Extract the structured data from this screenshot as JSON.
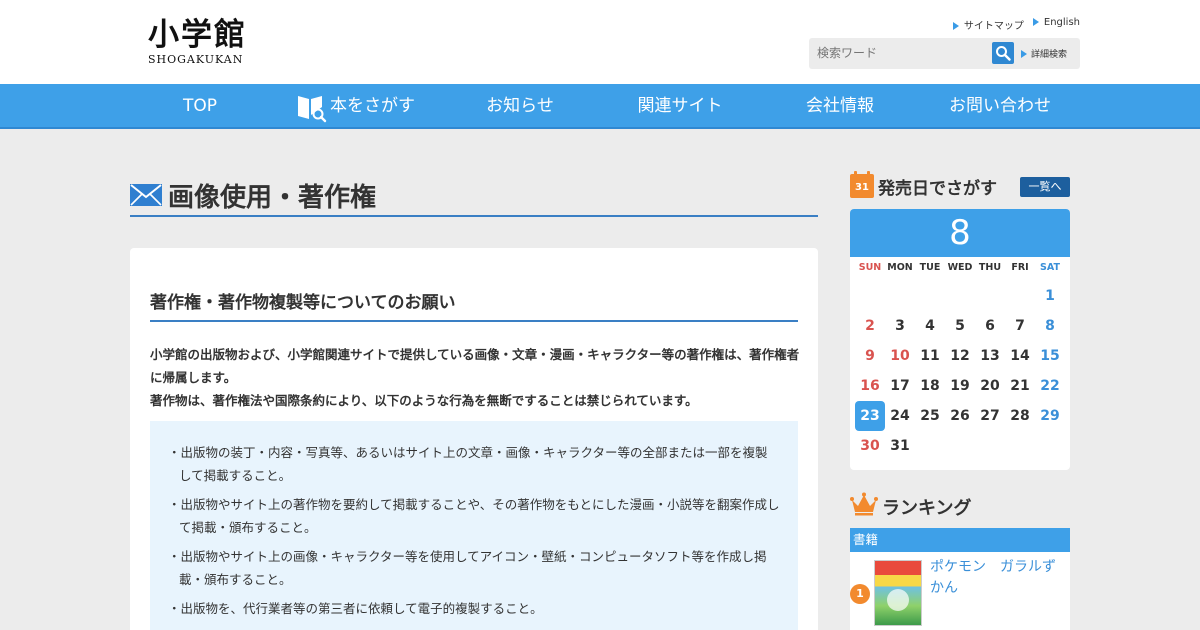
{
  "header": {
    "logo_jp": "小学館",
    "logo_en": "SHOGAKUKAN",
    "links": [
      "サイトマップ",
      "English"
    ],
    "search": {
      "placeholder": "検索ワード",
      "advanced_label": "詳細検索"
    }
  },
  "nav": {
    "items": [
      "TOP",
      "本をさがす",
      "お知らせ",
      "関連サイト",
      "会社情報",
      "お問い合わせ"
    ]
  },
  "main": {
    "title": "画像使用・著作権",
    "section_title": "著作権・著作物複製等についてのお願い",
    "intro_line1": "小学館の出版物および、小学館関連サイトで提供している画像・文章・漫画・キャラクター等の著作権は、著作権者に帰属します。",
    "intro_line2": "著作物は、著作権法や国際条約により、以下のような行為を無断ですることは禁じられています。",
    "notices": [
      "・出版物の装丁・内容・写真等、あるいはサイト上の文章・画像・キャラクター等の全部または一部を複製して掲載すること。",
      "・出版物やサイト上の著作物を要約して掲載することや、その著作物をもとにした漫画・小説等を翻案作成して掲載・頒布すること。",
      "・出版物やサイト上の画像・キャラクター等を使用してアイコン・壁紙・コンピュータソフト等を作成し掲載・頒布すること。",
      "・出版物を、代行業者等の第三者に依頼して電子的複製すること。"
    ]
  },
  "sidebar": {
    "calendar": {
      "icon_text": "31",
      "title": "発売日でさがす",
      "list_button": "一覧へ",
      "month": "8",
      "weekdays": [
        "SUN",
        "MON",
        "TUE",
        "WED",
        "THU",
        "FRI",
        "SAT"
      ],
      "weeks": [
        [
          "",
          "",
          "",
          "",
          "",
          "",
          "1"
        ],
        [
          "2",
          "3",
          "4",
          "5",
          "6",
          "7",
          "8"
        ],
        [
          "9",
          "10",
          "11",
          "12",
          "13",
          "14",
          "15"
        ],
        [
          "16",
          "17",
          "18",
          "19",
          "20",
          "21",
          "22"
        ],
        [
          "23",
          "24",
          "25",
          "26",
          "27",
          "28",
          "29"
        ],
        [
          "30",
          "31",
          "",
          "",
          "",
          "",
          ""
        ]
      ],
      "holidays": [
        "10"
      ],
      "today": "23",
      "colors": {
        "sunday": "#d9534f",
        "saturday": "#3a8fd8",
        "today_bg": "#3ea0e8"
      }
    },
    "ranking": {
      "title": "ランキング",
      "tab": "書籍",
      "items": [
        {
          "rank": "1",
          "title": "ポケモン　ガラルずかん"
        }
      ]
    }
  },
  "colors": {
    "accent": "#3ea0e8",
    "accent_dark": "#2f88d2",
    "rule": "#3a7fc4",
    "orange": "#f28a2e",
    "notice_bg": "#e8f4fd"
  }
}
